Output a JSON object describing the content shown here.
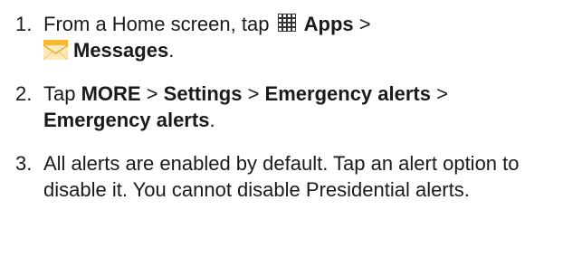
{
  "steps": [
    {
      "number": "1.",
      "text_1": "From a Home screen, tap ",
      "apps_icon": "apps-grid-icon",
      "apps_label": "Apps",
      "sep_1": " >",
      "messages_icon": "messages-envelope-icon",
      "messages_label": "Messages",
      "end": "."
    },
    {
      "number": "2.",
      "text_1": "Tap ",
      "more_label": "MORE",
      "sep_1": " > ",
      "settings_label": "Settings",
      "sep_2": " > ",
      "emergency_alerts_label_1": "Emergency alerts",
      "sep_3": " >",
      "emergency_alerts_label_2": "Emergency alerts",
      "end": "."
    },
    {
      "number": "3.",
      "text": "All alerts are enabled by default. Tap an alert option to disable it. You cannot disable Presidential alerts."
    }
  ],
  "colors": {
    "text": "#1a1a1a",
    "envelope_top": "#f7b731",
    "envelope_body": "#fde8b8"
  }
}
